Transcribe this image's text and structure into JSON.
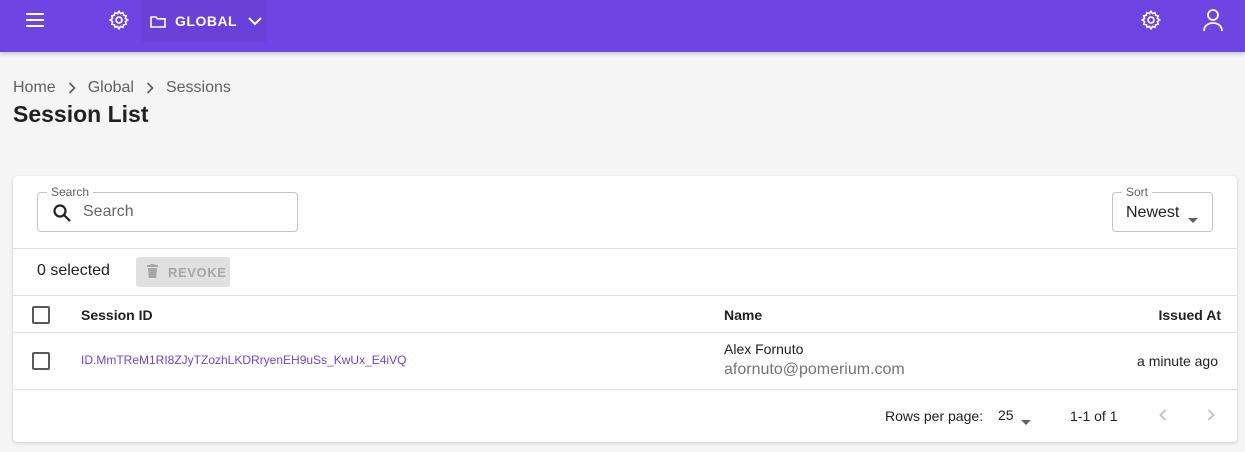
{
  "topbar": {
    "namespace": "GLOBAL",
    "menu_icon": "menu-icon",
    "settings_icon": "gear-icon",
    "folder_icon": "folder-icon",
    "user_icon": "person-icon",
    "bg_color": "#6e44e3"
  },
  "breadcrumb": [
    "Home",
    "Global",
    "Sessions"
  ],
  "page": {
    "title": "Session List"
  },
  "filters": {
    "search_label": "Search",
    "search_placeholder": "Search",
    "sort_label": "Sort",
    "sort_value": "Newest"
  },
  "toolbar": {
    "selected_text": "0 selected",
    "revoke_label": "REVOKE",
    "revoke_icon": "trash-icon"
  },
  "table": {
    "columns": [
      "Session ID",
      "Name",
      "Issued At"
    ],
    "rows": [
      {
        "session_id": "ID.MmTReM1RI8ZJyTZozhLKDRryenEH9uSs_KwUx_E4iVQ",
        "name": "Alex Fornuto",
        "email": "afornuto@pomerium.com",
        "issued_at": "a minute ago"
      }
    ]
  },
  "pagination": {
    "rows_per_page_label": "Rows per page:",
    "rows_per_page": "25",
    "range": "1-1 of 1"
  },
  "colors": {
    "accent": "#6e44e3"
  }
}
